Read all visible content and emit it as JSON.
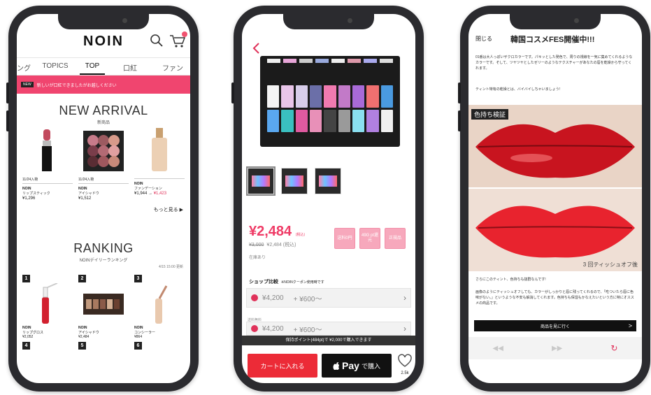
{
  "phone1": {
    "logo": "NOIN",
    "tabs": [
      "ング",
      "TOPICS",
      "TOP",
      "口紅",
      "ファン"
    ],
    "banner": {
      "badge": "NEW",
      "text": "新しいが口紅できましたがお越しください"
    },
    "new_arrival": {
      "title": "NEW ARRIVAL",
      "subtitle": "新商品",
      "products": [
        {
          "date": "11/24入荷",
          "brand": "NOIN",
          "name": "リップスティック",
          "price": "¥1,296",
          "sale_price": ""
        },
        {
          "date": "11/24入荷",
          "brand": "NOIN",
          "name": "アイシャドウ",
          "price": "¥1,512",
          "sale_price": ""
        },
        {
          "date": "",
          "brand": "NOIN",
          "name": "ファンデーション",
          "price": "¥1,944",
          "sale_price": "¥1,423"
        }
      ],
      "more": "もっと見る ▶"
    },
    "ranking": {
      "title": "RANKING",
      "subtitle": "NOINデイリーランキング",
      "date": "4/15 15:00 更新",
      "items": [
        {
          "rank": "1",
          "brand": "NOIN",
          "name": "リップグロス",
          "price": "¥2,052"
        },
        {
          "rank": "2",
          "brand": "NOIN",
          "name": "アイシャドウ",
          "price": "¥2,484"
        },
        {
          "rank": "3",
          "brand": "NOIN",
          "name": "コンシーラー",
          "price": "¥864"
        }
      ],
      "next_ranks": [
        "4",
        "5",
        "6"
      ]
    }
  },
  "phone2": {
    "price": "¥2,484",
    "price_tax_label": "(税込)",
    "original_price": "¥3,000",
    "sub_price": "¥2,484",
    "sub_price_label": "(税込)",
    "stock": "在庫あり",
    "tags": [
      "送料0円",
      "49G pt還元",
      "正規品"
    ],
    "shop_title": "ショップ比較",
    "shop_note_inline": "※NOINクーポン使用時です",
    "shops": [
      {
        "price": "¥4,200",
        "points": "+ ¥600～"
      },
      {
        "price": "¥4,200",
        "points": "+ ¥600～"
      }
    ],
    "shop_note": "送料無料",
    "points_bar": "保持ポイント(484pt)で ¥2,000で購入できます",
    "cart_button": "カートに入れる",
    "pay_button": {
      "brand": "Pay",
      "suffix": "で購入"
    },
    "likes": "2.5k"
  },
  "phone3": {
    "close": "閉じる",
    "title": "韓国コスメFES開催中!!!",
    "para1": "01番は大人っぽいザクロカラーです。パキッとした発色で、周りの視線を一気に集めてくれるようなカラーです。そして、ツヤツヤとしたゼリーのようなテクスチャーがあなたの唇を乾燥から守ってくれます。",
    "para2": "ティント特有の乾燥とは、バイバイしちゃいましょう!",
    "image1_label": "色持ち検証",
    "image2_caption": "3 回ティッシュオフ後",
    "para3": "さらにこのティント、色持ちも抜群なんです!",
    "para4": "画像のようにティッシュオフしても、カラーがしっかりと唇に残ってくれるので、「吃ついたら唇に色味がない。」というような不安も解消してくれます。色持ちも保湿もかなえたいという方に特にオススメの商品です。",
    "goto_button": "商品を見に行く",
    "goto_chevron": ">",
    "browser": {
      "back": "◀◀",
      "forward": "▶▶",
      "refresh": "↻"
    }
  }
}
